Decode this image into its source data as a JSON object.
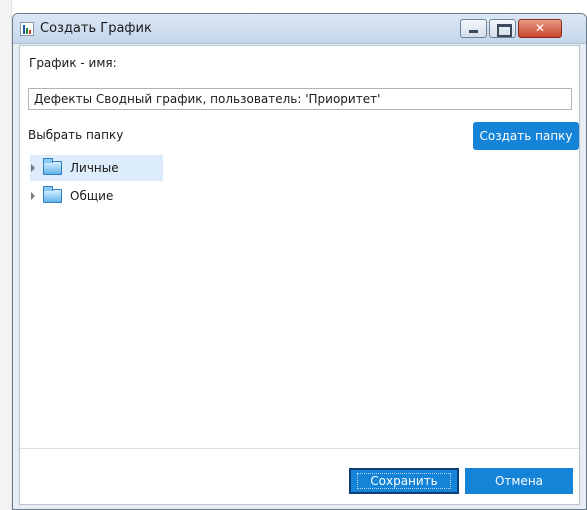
{
  "window": {
    "title": "Создать График",
    "close_glyph": "✕"
  },
  "form": {
    "name_label": "График - имя:",
    "name_value": "Дефекты Сводный график, пользователь: 'Приоритет'",
    "folder_label": "Выбрать папку",
    "create_folder_button": "Создать папку"
  },
  "tree": {
    "items": [
      {
        "label": "Личные",
        "icon": "folder-icon",
        "selected": true
      },
      {
        "label": "Общие",
        "icon": "folder-icon",
        "selected": false
      }
    ]
  },
  "footer": {
    "save_label": "Сохранить",
    "cancel_label": "Отмена"
  },
  "colors": {
    "accent": "#1583d8",
    "selection": "#dcecfb"
  }
}
